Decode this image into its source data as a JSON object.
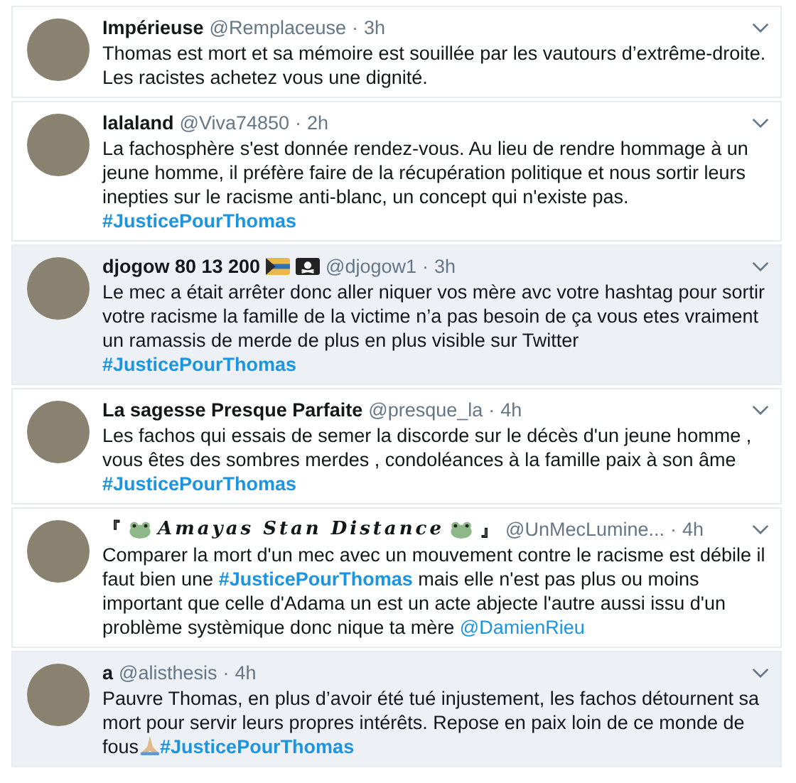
{
  "tweets": [
    {
      "highlighted": false,
      "name": [
        {
          "kind": "text",
          "text": "Impérieuse"
        }
      ],
      "handle": "@Remplaceuse",
      "dot": "·",
      "time": "3h",
      "body": [
        {
          "kind": "text",
          "text": "Thomas est mort et sa mémoire est souillée par les vautours d’extrême-droite. Les racistes achetez vous une dignité."
        }
      ]
    },
    {
      "highlighted": false,
      "name": [
        {
          "kind": "text",
          "text": "lalaland"
        }
      ],
      "handle": "@Viva74850",
      "dot": "·",
      "time": "2h",
      "body": [
        {
          "kind": "text",
          "text": "La fachosphère s'est donnée rendez-vous. Au lieu de rendre hommage à un jeune homme, il préfère faire de la récupération politique et nous sortir leurs inepties sur le racisme anti-blanc, un concept qui n'existe pas. "
        },
        {
          "kind": "hashtag",
          "text": "#JusticePourThomas"
        }
      ]
    },
    {
      "highlighted": true,
      "name": [
        {
          "kind": "text",
          "text": "djogow 80 13 200"
        },
        {
          "kind": "flag"
        },
        {
          "kind": "pirate"
        }
      ],
      "handle": "@djogow1",
      "dot": "·",
      "time": "3h",
      "body": [
        {
          "kind": "text",
          "text": "Le mec a était arrêter donc aller niquer vos mère avc votre hashtag pour sortir votre racisme la famille de la victime n’a pas besoin de ça vous etes vraiment un ramassis de merde de plus en plus visible sur Twitter "
        },
        {
          "kind": "hashtag",
          "text": "#JusticePourThomas"
        }
      ]
    },
    {
      "highlighted": false,
      "name": [
        {
          "kind": "text",
          "text": "La sagesse Presque Parfaite"
        }
      ],
      "handle": "@presque_la",
      "dot": "·",
      "time": "4h",
      "body": [
        {
          "kind": "text",
          "text": "Les fachos qui essais de semer la discorde sur le décès d'un jeune homme , vous êtes des sombres merdes , condoléances à la famille paix à son âme "
        },
        {
          "kind": "hashtag",
          "text": "#JusticePourThomas"
        }
      ]
    },
    {
      "highlighted": false,
      "name": [
        {
          "kind": "text",
          "text": "『"
        },
        {
          "kind": "frog"
        },
        {
          "kind": "styled",
          "text": "Amayas Stan Distance"
        },
        {
          "kind": "frog"
        },
        {
          "kind": "text",
          "text": "』"
        }
      ],
      "handle": "@UnMecLumine...",
      "dot": "·",
      "time": "4h",
      "body": [
        {
          "kind": "text",
          "text": "Comparer la mort d'un mec avec un mouvement contre le racisme est débile il faut bien une "
        },
        {
          "kind": "hashtag",
          "text": "#JusticePourThomas"
        },
        {
          "kind": "text",
          "text": " mais elle n'est pas plus ou moins important que celle d'Adama un est un acte abjecte l'autre aussi issu d'un problème systèmique donc nique ta mère "
        },
        {
          "kind": "mention",
          "text": "@DamienRieu"
        }
      ]
    },
    {
      "highlighted": true,
      "name": [
        {
          "kind": "text",
          "text": "a"
        }
      ],
      "handle": "@alisthesis",
      "dot": "·",
      "time": "4h",
      "body": [
        {
          "kind": "text",
          "text": "Pauvre Thomas, en plus d’avoir été tué injustement, les fachos détournent sa mort pour servir leurs propres intérêts. Repose en paix loin de ce monde de fous"
        },
        {
          "kind": "prayer"
        },
        {
          "kind": "hashtag",
          "text": "#JusticePourThomas"
        }
      ]
    }
  ]
}
